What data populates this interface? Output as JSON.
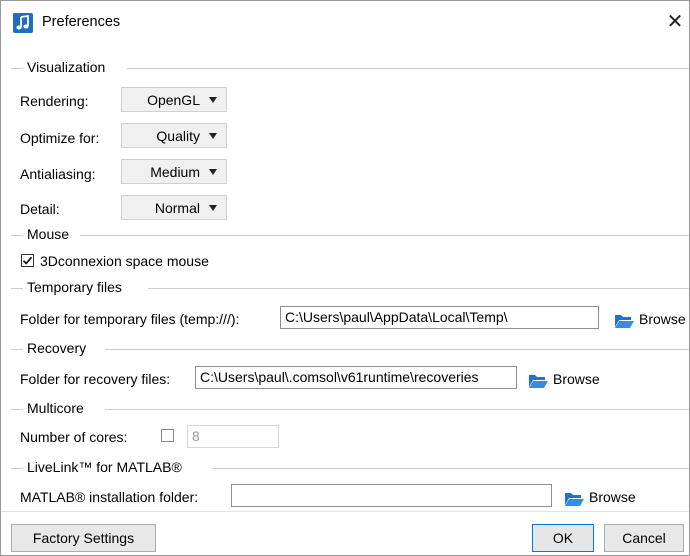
{
  "window": {
    "title": "Preferences",
    "close_symbol": "✕"
  },
  "visualization": {
    "section_label": "Visualization",
    "rendering": {
      "label": "Rendering:",
      "value": "OpenGL"
    },
    "optimize": {
      "label": "Optimize for:",
      "value": "Quality"
    },
    "antialiasing": {
      "label": "Antialiasing:",
      "value": "Medium"
    },
    "detail": {
      "label": "Detail:",
      "value": "Normal"
    }
  },
  "mouse": {
    "section_label": "Mouse",
    "space_mouse": {
      "label": "3Dconnexion space mouse",
      "checked": true
    }
  },
  "temporary_files": {
    "section_label": "Temporary files",
    "folder_label": "Folder for temporary files (temp:///):",
    "folder_value": "C:\\Users\\paul\\AppData\\Local\\Temp\\",
    "browse_label": "Browse"
  },
  "recovery": {
    "section_label": "Recovery",
    "folder_label": "Folder for recovery files:",
    "folder_value": "C:\\Users\\paul\\.comsol\\v61runtime\\recoveries",
    "browse_label": "Browse"
  },
  "multicore": {
    "section_label": "Multicore",
    "cores_label": "Number of cores:",
    "cores_checked": false,
    "cores_value": "8"
  },
  "livelink": {
    "section_label": "LiveLink™ for MATLAB®",
    "folder_label": "MATLAB® installation folder:",
    "folder_value": "",
    "browse_label": "Browse"
  },
  "footer": {
    "factory_label": "Factory Settings",
    "ok_label": "OK",
    "cancel_label": "Cancel"
  },
  "colors": {
    "accent": "#1e6fbf",
    "folder_icon": "#1e73d2",
    "ok_border": "#0078d7"
  }
}
